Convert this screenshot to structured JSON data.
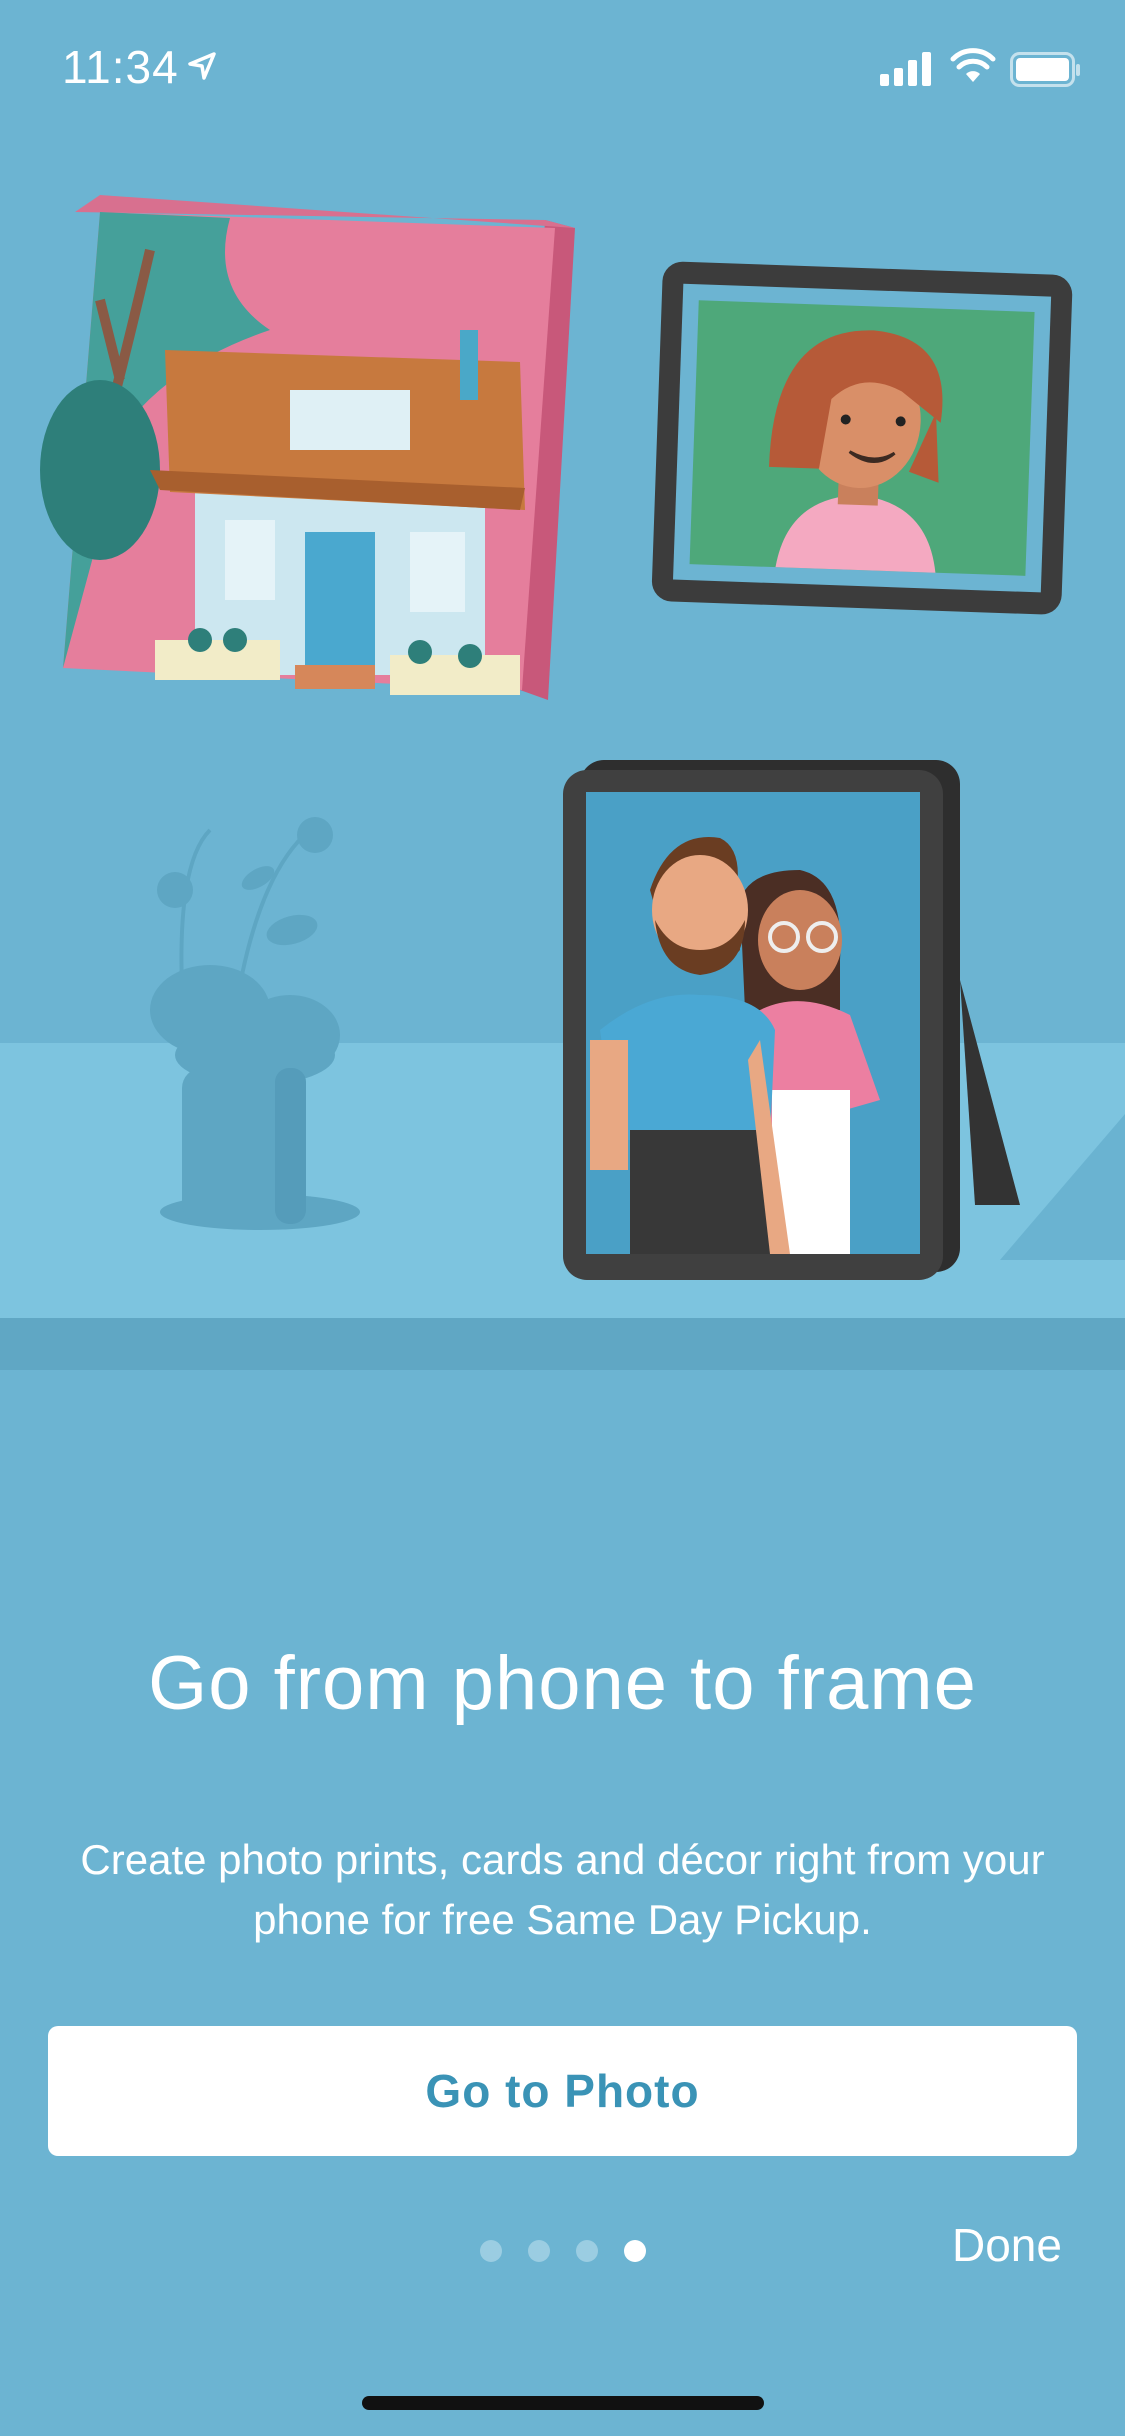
{
  "status": {
    "time": "11:34",
    "icons": [
      "location-arrow-icon",
      "signal-bars-icon",
      "wifi-icon",
      "battery-icon"
    ]
  },
  "illustration": {
    "icons": [
      "house-canvas-print-icon",
      "woman-photo-frame-icon",
      "couple-easel-frame-icon",
      "vase-plant-icon"
    ]
  },
  "onboarding": {
    "title": "Go from phone to frame",
    "subtitle": "Create photo prints, cards and décor right from your phone for free Same Day Pickup.",
    "cta_label": "Go to Photo",
    "done_label": "Done",
    "pages_total": 4,
    "current_page": 4
  },
  "colors": {
    "background": "#6cb4d2",
    "button_text": "#3a93b6",
    "button_bg": "#ffffff"
  }
}
